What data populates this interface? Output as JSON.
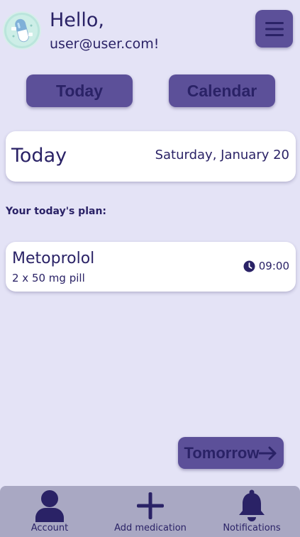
{
  "header": {
    "greeting": "Hello,",
    "email": "user@user.com!"
  },
  "nav_buttons": {
    "today": "Today",
    "calendar": "Calendar"
  },
  "date_card": {
    "title": "Today",
    "date": "Saturday, January 20"
  },
  "plan": {
    "label": "Your today's plan:",
    "items": [
      {
        "name": "Metoprolol",
        "dose": "2 x 50 mg pill",
        "time": "09:00"
      }
    ]
  },
  "tomorrow_button": {
    "label": "Tomorrow"
  },
  "bottom_nav": {
    "account": "Account",
    "add_medication": "Add medication",
    "notifications": "Notifications"
  },
  "colors": {
    "background": "#e4e3f6",
    "primary": "#5c5099",
    "text": "#2a2266",
    "bottom_bar": "#a9a8c3"
  },
  "icons": {
    "avatar": "pill-capsule-logo",
    "menu": "hamburger-menu-icon",
    "time": "clock-icon",
    "tomorrow": "arrow-right-icon",
    "account": "user-icon",
    "add": "plus-icon",
    "notifications": "bell-icon"
  }
}
